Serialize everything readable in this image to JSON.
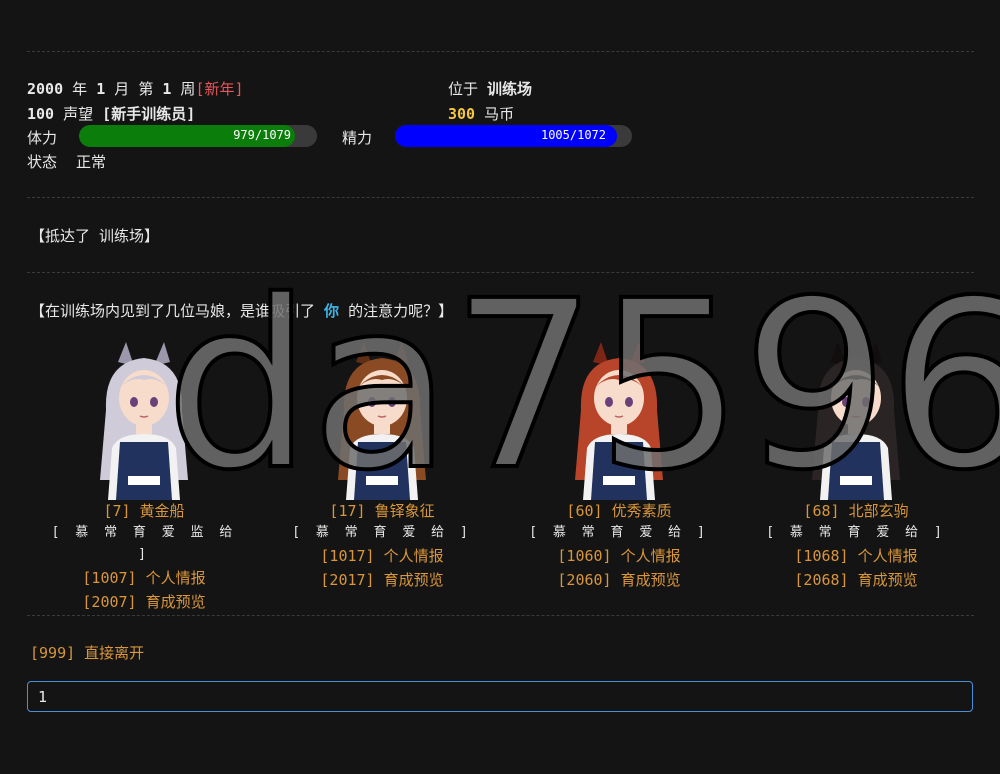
{
  "status": {
    "year": "2000",
    "year_unit": "年",
    "month": "1",
    "month_unit": "月",
    "week_prefix": "第",
    "week": "1",
    "week_unit": "周",
    "event": "[新年]",
    "location_label": "位于",
    "location": "训练场",
    "fame": "100",
    "fame_label": "声望",
    "title": "[新手训练员]",
    "money": "300",
    "money_label": "马币",
    "stamina_label": "体力",
    "stamina_text": "979/1079",
    "stamina_fraction": 0.907,
    "energy_label": "精力",
    "energy_text": "1005/1072",
    "energy_fraction": 0.9375,
    "condition_label": "状态",
    "condition": "正常",
    "colors": {
      "stamina": "#0a7d0a",
      "energy": "#0000ff",
      "event": "#e8555a",
      "money": "#f5c542",
      "link": "#d9963a",
      "highlight": "#3bb6e8"
    }
  },
  "log": {
    "arrival": "【抵达了 训练场】",
    "prompt_pre": "【在训练场内见到了几位马娘，是谁吸引了",
    "prompt_you": "你",
    "prompt_post": "的注意力呢？】"
  },
  "characters": [
    {
      "name": "[7] 黄金船",
      "tags": "[ 慕 常 育 爱 监 给 ]",
      "info": "[1007] 个人情报",
      "preview": "[2007] 育成预览",
      "hair": "#cfcbd8",
      "hair_dark": "#9c97aa"
    },
    {
      "name": "[17] 鲁铎象征",
      "tags": "[ 慕 常 育 爱 给 ]",
      "info": "[1017] 个人情报",
      "preview": "[2017] 育成预览",
      "hair": "#8a4a24",
      "hair_dark": "#5e2f15"
    },
    {
      "name": "[60] 优秀素质",
      "tags": "[ 慕 常 育 爱 给 ]",
      "info": "[1060] 个人情报",
      "preview": "[2060] 育成预览",
      "hair": "#b8442a",
      "hair_dark": "#7e2616"
    },
    {
      "name": "[68] 北部玄驹",
      "tags": "[ 慕 常 育 爱 给 ]",
      "info": "[1068] 个人情报",
      "preview": "[2068] 育成预览",
      "hair": "#2b2424",
      "hair_dark": "#120e0e"
    }
  ],
  "leave_option": "[999] 直接离开",
  "input": {
    "value": "1"
  },
  "watermark": "da7596"
}
